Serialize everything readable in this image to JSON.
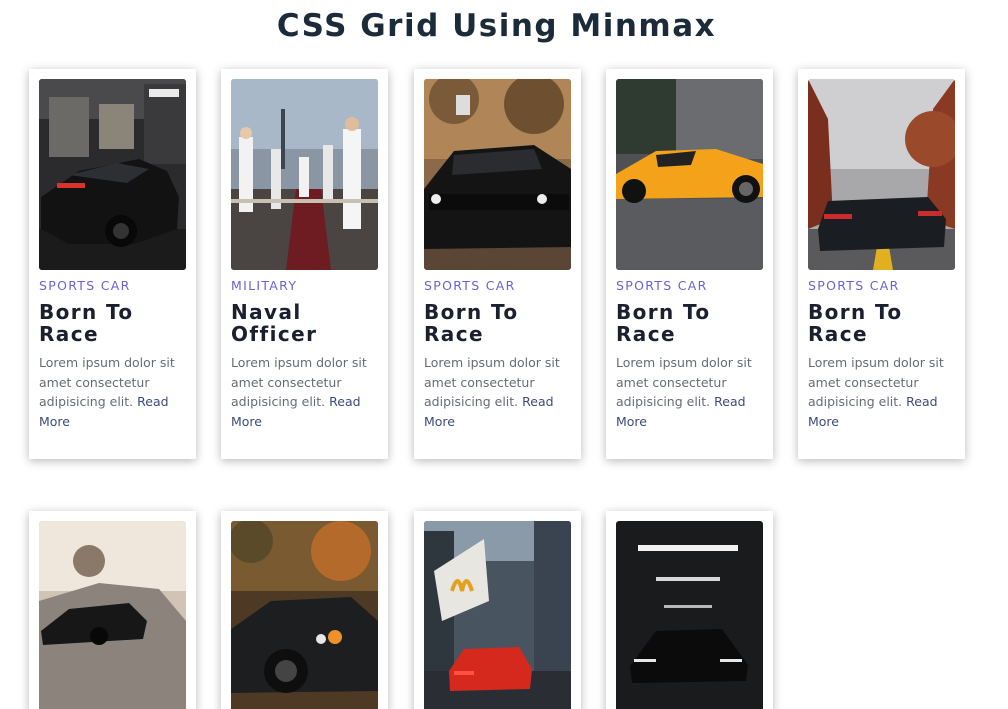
{
  "page": {
    "title": "CSS Grid Using Minmax"
  },
  "cards": [
    {
      "category": "SPORTS CAR",
      "title": "Born To Race",
      "text": "Lorem ipsum dolor sit amet consectetur adipisicing elit.",
      "link": "Read More"
    },
    {
      "category": "MILITARY",
      "title": "Naval Officer",
      "text": "Lorem ipsum dolor sit amet consectetur adipisicing elit.",
      "link": "Read More"
    },
    {
      "category": "SPORTS CAR",
      "title": "Born To Race",
      "text": "Lorem ipsum dolor sit amet consectetur adipisicing elit.",
      "link": "Read More"
    },
    {
      "category": "SPORTS CAR",
      "title": "Born To Race",
      "text": "Lorem ipsum dolor sit amet consectetur adipisicing elit.",
      "link": "Read More"
    },
    {
      "category": "SPORTS CAR",
      "title": "Born To Race",
      "text": "Lorem ipsum dolor sit amet consectetur adipisicing elit.",
      "link": "Read More"
    }
  ],
  "colors": {
    "title": "#1c2b3a",
    "category": "#6a62d8",
    "link": "#3d4b7c",
    "body_text": "#666b75"
  }
}
